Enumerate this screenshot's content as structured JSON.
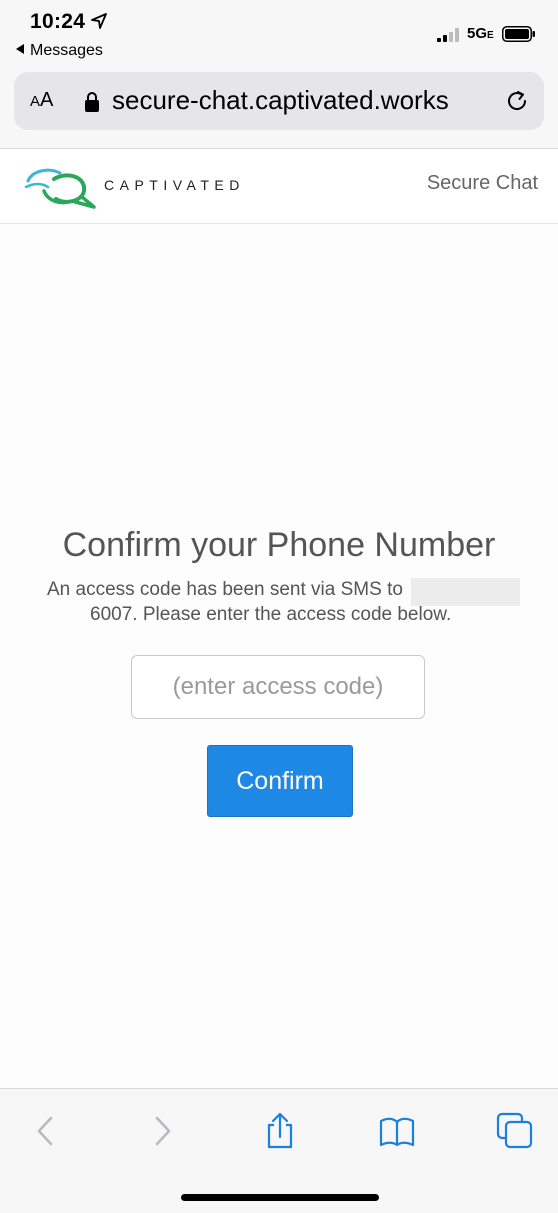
{
  "status_bar": {
    "time": "10:24",
    "back_label": "Messages",
    "network": "5G",
    "network_suffix": "E"
  },
  "browser": {
    "text_size_label_small": "A",
    "text_size_label_large": "A",
    "url": "secure-chat.captivated.works"
  },
  "site_header": {
    "brand": "CAPTIVATED",
    "nav_label": "Secure Chat"
  },
  "main": {
    "title": "Confirm your Phone Number",
    "message_line1": "An access code has been sent via SMS to",
    "message_line2": "6007. Please enter the access code below.",
    "access_code_placeholder": "(enter access code)",
    "access_code_value": "",
    "confirm_label": "Confirm"
  },
  "colors": {
    "primary_button": "#1e88e5",
    "toolbar_icon": "#1a7fe0",
    "toolbar_icon_disabled": "#b9b9be"
  },
  "toolbar_icons": [
    "back-icon",
    "forward-icon",
    "share-icon",
    "bookmarks-icon",
    "tabs-icon"
  ]
}
